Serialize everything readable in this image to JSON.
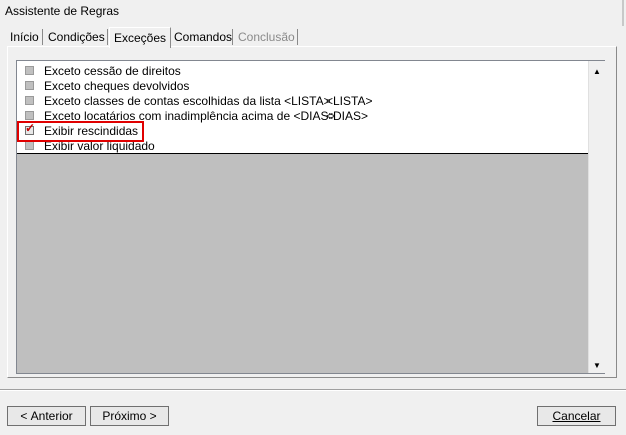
{
  "window": {
    "title": "Assistente de Regras"
  },
  "tabs": [
    {
      "label": "Início",
      "active": false,
      "enabled": true
    },
    {
      "label": "Condições",
      "active": false,
      "enabled": true
    },
    {
      "label": "Exceções",
      "active": true,
      "enabled": true
    },
    {
      "label": "Comandos",
      "active": false,
      "enabled": true
    },
    {
      "label": "Conclusão",
      "active": false,
      "enabled": false
    }
  ],
  "list": {
    "rows": [
      {
        "label": "Exceto cessão de direitos",
        "param": "",
        "checked": false
      },
      {
        "label": "Exceto cheques devolvidos",
        "param": "",
        "checked": false
      },
      {
        "label": "Exceto classes de contas escolhidas da lista <LISTA>",
        "param": "<LISTA>",
        "checked": false
      },
      {
        "label": "Exceto locatários com inadimplência acima de <DIAS>",
        "param": "<DIAS>",
        "checked": false
      },
      {
        "label": "Exibir rescindidas",
        "param": "",
        "checked": true
      },
      {
        "label": "Exibir valor liquidado",
        "param": "",
        "checked": false
      }
    ],
    "scroll_up_icon": "triangle-up",
    "scroll_down_icon": "triangle-down"
  },
  "buttons": {
    "back_prefix": "< ",
    "back_label": "Anterior",
    "next_label": "Próximo",
    "next_suffix": " >",
    "cancel_label": "Cancelar"
  },
  "colors": {
    "highlight": "#e00000",
    "checkmark": "#c00000"
  }
}
